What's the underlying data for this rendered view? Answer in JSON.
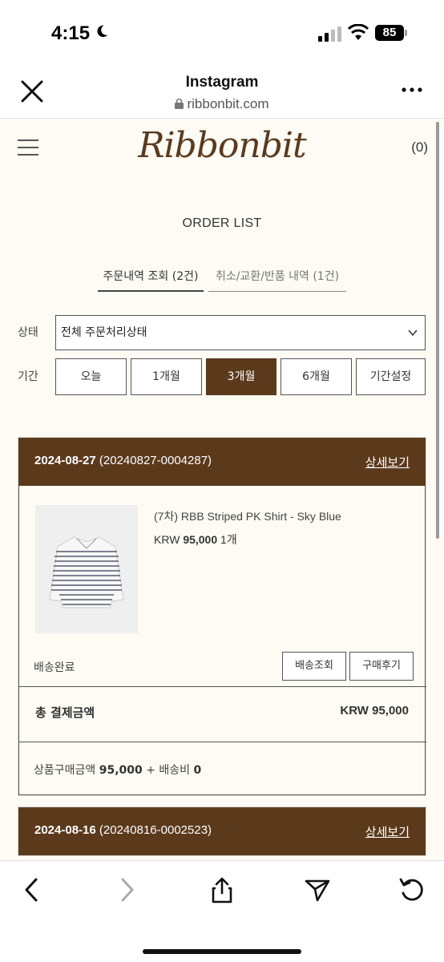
{
  "status_bar": {
    "time": "4:15",
    "battery": "85"
  },
  "browser": {
    "title": "Instagram",
    "url": "ribbonbit.com"
  },
  "site": {
    "logo": "Ribbonbit",
    "cart_count": "(0)",
    "page_title": "ORDER LIST",
    "tabs": [
      {
        "label": "주문내역 조회 (2건)"
      },
      {
        "label": "취소/교환/반품 내역 (1건)"
      }
    ],
    "filters": {
      "status_label": "상태",
      "status_value": "전체 주문처리상태",
      "period_label": "기간",
      "periods": [
        "오늘",
        "1개월",
        "3개월",
        "6개월",
        "기간설정"
      ],
      "active_period": "3개월"
    },
    "orders": [
      {
        "date": "2024-08-27",
        "order_no": "(20240827-0004287)",
        "detail_label": "상세보기",
        "product_name": "(7차) RBB Striped PK Shirt - Sky Blue",
        "currency": "KRW",
        "price": "95,000",
        "qty": "1개",
        "shipping_status": "배송완료",
        "track_btn": "배송조회",
        "review_btn": "구매후기",
        "total_label": "총 결제금액",
        "total_value": "KRW 95,000",
        "summary_prefix": "상품구매금액",
        "summary_amount": "95,000",
        "summary_mid": "+ 배송비",
        "summary_shipping": "0"
      },
      {
        "date": "2024-08-16",
        "order_no": "(20240816-0002523)",
        "detail_label": "상세보기"
      }
    ]
  }
}
